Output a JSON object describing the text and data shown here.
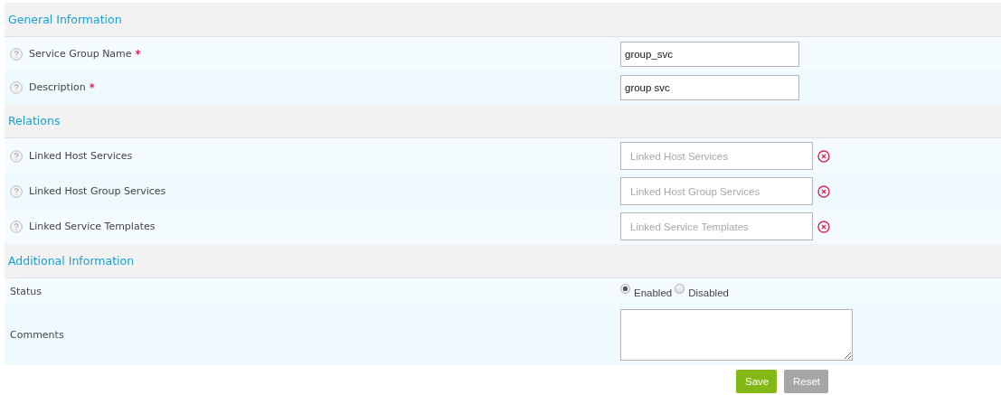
{
  "sections": [
    {
      "title": "General Information",
      "rows": [
        {
          "kind": "text",
          "label": "Service Group Name",
          "help": true,
          "required_mark": "*",
          "value": "group_svc"
        },
        {
          "kind": "text",
          "label": "Description",
          "help": true,
          "required_mark": "*",
          "value": "group svc"
        }
      ]
    },
    {
      "title": "Relations",
      "rows": [
        {
          "kind": "multiselect",
          "label": "Linked Host Services",
          "help": true,
          "placeholder": "Linked Host Services"
        },
        {
          "kind": "multiselect",
          "label": "Linked Host Group Services",
          "help": true,
          "placeholder": "Linked Host Group Services"
        },
        {
          "kind": "multiselect",
          "label": "Linked Service Templates",
          "help": true,
          "placeholder": "Linked Service Templates"
        }
      ]
    },
    {
      "title": "Additional Information",
      "rows": [
        {
          "kind": "radio",
          "label": "Status",
          "options": [
            {
              "label": "Enabled",
              "selected": true
            },
            {
              "label": "Disabled",
              "selected": false
            }
          ]
        },
        {
          "kind": "textarea",
          "label": "Comments"
        }
      ]
    }
  ],
  "buttons": [
    {
      "kind": "primary",
      "label": "Save"
    },
    {
      "kind": "secondary",
      "label": "Reset"
    }
  ]
}
